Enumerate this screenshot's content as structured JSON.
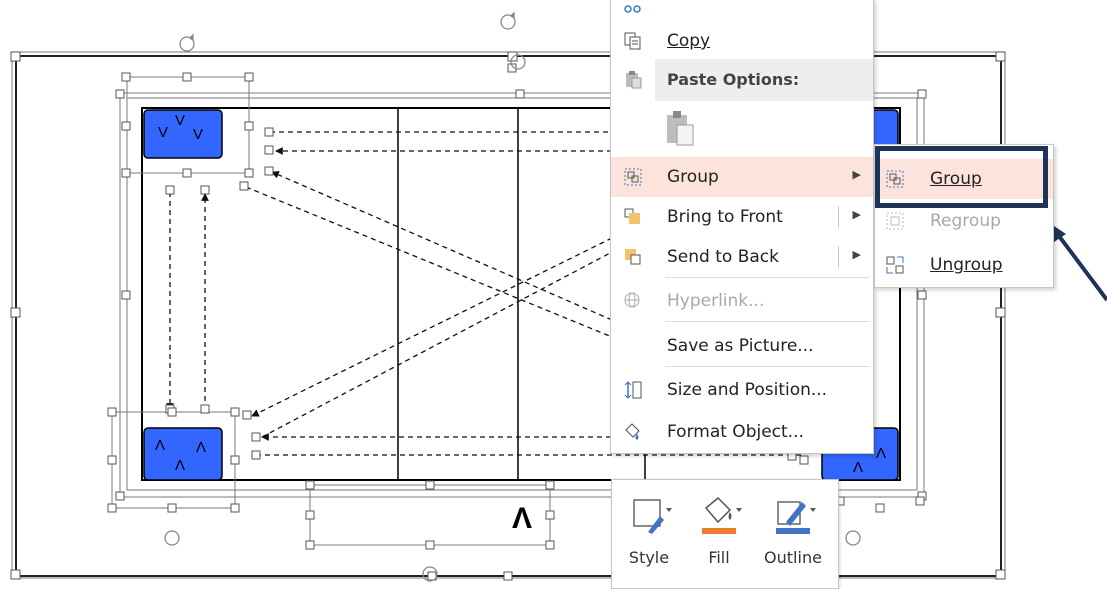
{
  "colors": {
    "shape_blue": "#3366ff",
    "highlight_border": "#1e3358",
    "menu_hover": "#fce4dc",
    "fill_orange": "#ed7d31",
    "outline_blue": "#4472c4",
    "arrow_navy": "#1e3358"
  },
  "slide": {
    "shape_labels": {
      "top_left": [
        "V",
        "V",
        "V"
      ],
      "bottom_left": [
        "Λ",
        "Λ",
        "Λ"
      ],
      "bottom_right": [
        "Λ",
        "Λ"
      ],
      "free_text": "Λ"
    }
  },
  "context_menu": {
    "items": [
      {
        "id": "copy",
        "label": "Copy",
        "icon": "copy-icon"
      },
      {
        "id": "paste-options",
        "label": "Paste Options:",
        "icon": "paste-icon"
      },
      {
        "id": "group",
        "label": "Group",
        "icon": "group-icon",
        "submenu": true,
        "highlighted": true
      },
      {
        "id": "bring-front",
        "label": "Bring to Front",
        "icon": "bring-to-front-icon",
        "submenu": true
      },
      {
        "id": "send-back",
        "label": "Send to Back",
        "icon": "send-to-back-icon",
        "submenu": true
      },
      {
        "id": "hyperlink",
        "label": "Hyperlink...",
        "icon": "hyperlink-icon",
        "disabled": true
      },
      {
        "id": "save-picture",
        "label": "Save as Picture..."
      },
      {
        "id": "size-position",
        "label": "Size and Position...",
        "icon": "size-position-icon"
      },
      {
        "id": "format-object",
        "label": "Format Object...",
        "icon": "format-object-icon"
      }
    ]
  },
  "submenu": {
    "items": [
      {
        "id": "group",
        "label": "Group",
        "icon": "group-icon",
        "highlighted": true
      },
      {
        "id": "regroup",
        "label": "Regroup",
        "icon": "regroup-icon",
        "disabled": true
      },
      {
        "id": "ungroup",
        "label": "Ungroup",
        "icon": "ungroup-icon"
      }
    ]
  },
  "mini_toolbar": {
    "style_label": "Style",
    "fill_label": "Fill",
    "outline_label": "Outline"
  }
}
